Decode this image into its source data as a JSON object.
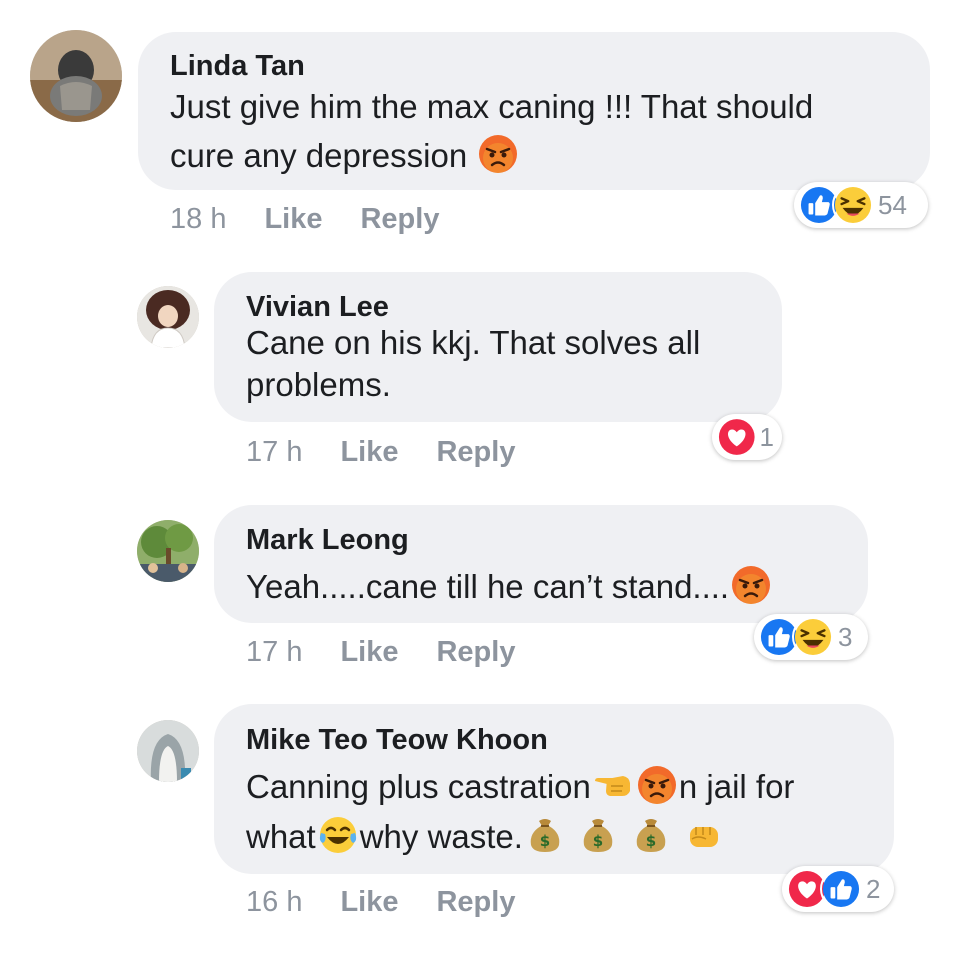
{
  "comments": [
    {
      "author": "Linda Tan",
      "lines": [
        "Just give him the max caning !!! That should",
        "cure any depression"
      ],
      "time": "18 h",
      "like_label": "Like",
      "reply_label": "Reply",
      "reactions": [
        "like-icon",
        "haha-icon"
      ],
      "reaction_count": "54"
    },
    {
      "author": "Vivian Lee",
      "lines": [
        "Cane on his kkj. That solves all",
        "problems."
      ],
      "time": "17 h",
      "like_label": "Like",
      "reply_label": "Reply",
      "reactions": [
        "love-icon"
      ],
      "reaction_count": "1"
    },
    {
      "author": "Mark Leong",
      "lines": [
        "Yeah.....cane till he can’t stand...."
      ],
      "time": "17 h",
      "like_label": "Like",
      "reply_label": "Reply",
      "reactions": [
        "like-icon",
        "haha-icon"
      ],
      "reaction_count": "3"
    },
    {
      "author": "Mike Teo Teow Khoon",
      "lines": [
        "Canning plus castration",
        "n jail for",
        "what",
        "why waste."
      ],
      "time": "16 h",
      "like_label": "Like",
      "reply_label": "Reply",
      "reactions": [
        "love-icon",
        "like-icon"
      ],
      "reaction_count": "2"
    }
  ],
  "colors": {
    "bubble": "#eff0f3",
    "meta": "#8d949e",
    "like_blue": "#1877f2",
    "love_red": "#f0284a",
    "angry_face": "#e9521d"
  }
}
